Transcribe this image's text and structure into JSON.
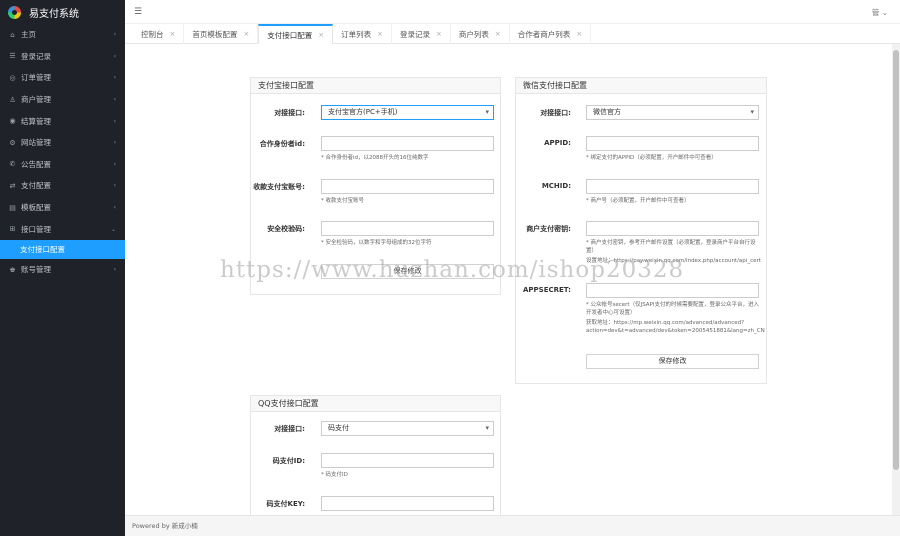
{
  "app": {
    "title": "易支付系统"
  },
  "sidebar": {
    "items": [
      {
        "icon": "home-icon",
        "glyph": "⌂",
        "label": "主页",
        "arrow": "‹"
      },
      {
        "icon": "list-icon",
        "glyph": "☰",
        "label": "登录记录",
        "arrow": "‹"
      },
      {
        "icon": "order-icon",
        "glyph": "◎",
        "label": "订单管理",
        "arrow": "‹"
      },
      {
        "icon": "merchant-icon",
        "glyph": "♙",
        "label": "商户管理",
        "arrow": "‹"
      },
      {
        "icon": "settle-icon",
        "glyph": "◉",
        "label": "结算管理",
        "arrow": "‹"
      },
      {
        "icon": "site-icon",
        "glyph": "⚙",
        "label": "网站管理",
        "arrow": "‹"
      },
      {
        "icon": "notice-icon",
        "glyph": "✆",
        "label": "公告配置",
        "arrow": "‹"
      },
      {
        "icon": "recharge-icon",
        "glyph": "⇄",
        "label": "支付配置",
        "arrow": "‹"
      },
      {
        "icon": "template-icon",
        "glyph": "▤",
        "label": "模板配置",
        "arrow": "‹"
      },
      {
        "icon": "interface-icon",
        "glyph": "⊞",
        "label": "接口管理",
        "arrow": "⌄"
      }
    ],
    "active_sub": "支付接口配置",
    "after": {
      "icon": "account-icon",
      "glyph": "♚",
      "label": "账号管理",
      "arrow": "‹"
    }
  },
  "topbar": {
    "menu_glyph": "☰",
    "user": "管 ⌄"
  },
  "tabs": [
    {
      "label": "控制台",
      "close": "×"
    },
    {
      "label": "首页模板配置",
      "close": "×"
    },
    {
      "label": "支付接口配置",
      "close": "×",
      "active": true
    },
    {
      "label": "订单列表",
      "close": "×"
    },
    {
      "label": "登录记录",
      "close": "×"
    },
    {
      "label": "商户列表",
      "close": "×"
    },
    {
      "label": "合作者商户列表",
      "close": "×"
    }
  ],
  "alipay": {
    "title": "支付宝接口配置",
    "iface_label": "对接接口:",
    "iface_value": "支付宝官方(PC+手机)",
    "pid_label": "合作身份者id:",
    "pid_help": "* 合作身份者id，以2088开头的16位纯数字",
    "account_label": "收款支付宝账号:",
    "account_help": "* 收款支付宝账号",
    "key_label": "安全校验码:",
    "key_help": "* 安全检验码，以数字和字母组成的32位字符",
    "save": "保存修改"
  },
  "wxpay": {
    "title": "微信支付接口配置",
    "iface_label": "对接接口:",
    "iface_value": "微信官方",
    "appid_label": "APPID:",
    "appid_help": "* 绑定支付的APPID（必须配置，开户邮件中可查看）",
    "mchid_label": "MCHID:",
    "mchid_help": "* 商户号（必须配置，开户邮件中可查看）",
    "key_label": "商户支付密钥:",
    "key_help": "* 商户支付密钥，参考开户邮件设置（必须配置，登录商户平台自行设置）",
    "key_link": "设置地址：https://pay.weixin.qq.com/index.php/account/api_cert",
    "secret_label": "APPSECRET:",
    "secret_help": "* 公众帐号secert（仅JSAPI支付的时候需要配置，登录公众平台，进入开发者中心可设置）",
    "secret_link": "获取地址：https://mp.weixin.qq.com/advanced/advanced?action=dev&t=advanced/dev&token=2005451881&lang=zh_CN",
    "save": "保存修改"
  },
  "qqpay": {
    "title": "QQ支付接口配置",
    "iface_label": "对接接口:",
    "iface_value": "码支付",
    "id_label": "码支付ID:",
    "id_help": "* 码支付ID",
    "key_label": "码支付KEY:"
  },
  "footer": {
    "text": "Powered by 新成小楠"
  },
  "watermark": "https://www.huzhan.com/ishop20328"
}
